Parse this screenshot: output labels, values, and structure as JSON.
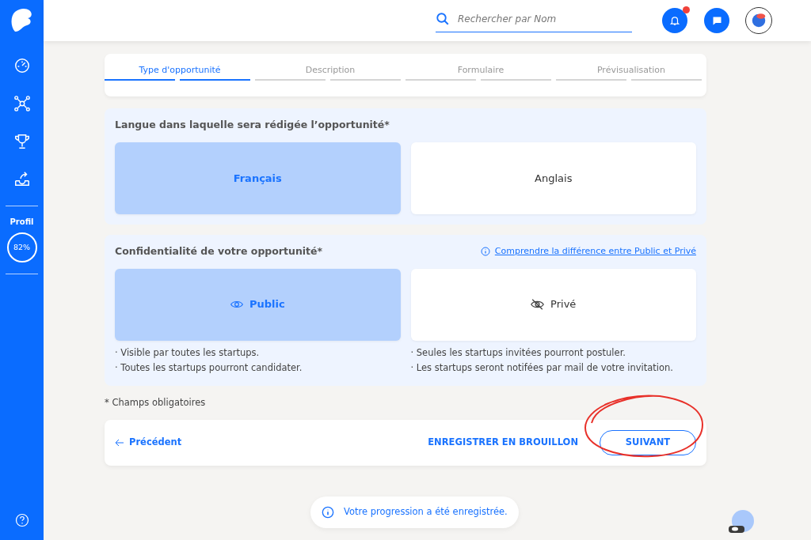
{
  "sidebar": {
    "items": [
      {
        "kind": "dashboard",
        "selected": false
      },
      {
        "kind": "network",
        "selected": false
      },
      {
        "kind": "trophy",
        "selected": false
      },
      {
        "kind": "share",
        "selected": false
      }
    ],
    "profile": {
      "label": "Profil",
      "value": "82%"
    }
  },
  "header": {
    "search": {
      "placeholder": "Rechercher par Nom"
    },
    "notifications": {
      "unread": true
    }
  },
  "steps": [
    {
      "label": "Type d'opportunité",
      "selected": true
    },
    {
      "label": "Description",
      "selected": false
    },
    {
      "label": "Formulaire",
      "selected": false
    },
    {
      "label": "Prévisualisation",
      "selected": false
    }
  ],
  "language": {
    "title": "Langue dans laquelle sera rédigée l’opportunité*",
    "options": [
      {
        "label": "Français",
        "selected": true
      },
      {
        "label": "Anglais",
        "selected": false
      }
    ]
  },
  "privacy": {
    "title": "Confidentialité de votre opportunité*",
    "help_link": "Comprendre la différence entre Public et Privé",
    "options": [
      {
        "label": "Public",
        "kind": "eye",
        "selected": true,
        "notes": [
          "· Visible par toutes les startups.",
          "· Toutes les startups pourront candidater."
        ]
      },
      {
        "label": "Privé",
        "kind": "eye-off",
        "selected": false,
        "notes": [
          "· Seules les startups invitées pourront postuler.",
          "· Les startups seront notifées par mail de votre invitation."
        ]
      }
    ]
  },
  "required_note": "* Champs obligatoires",
  "footer": {
    "back": "Précédent",
    "draft": "ENREGISTRER EN BROUILLON",
    "next": "SUIVANT",
    "next_circled": true
  },
  "toast": "Votre progression a été enregistrée."
}
